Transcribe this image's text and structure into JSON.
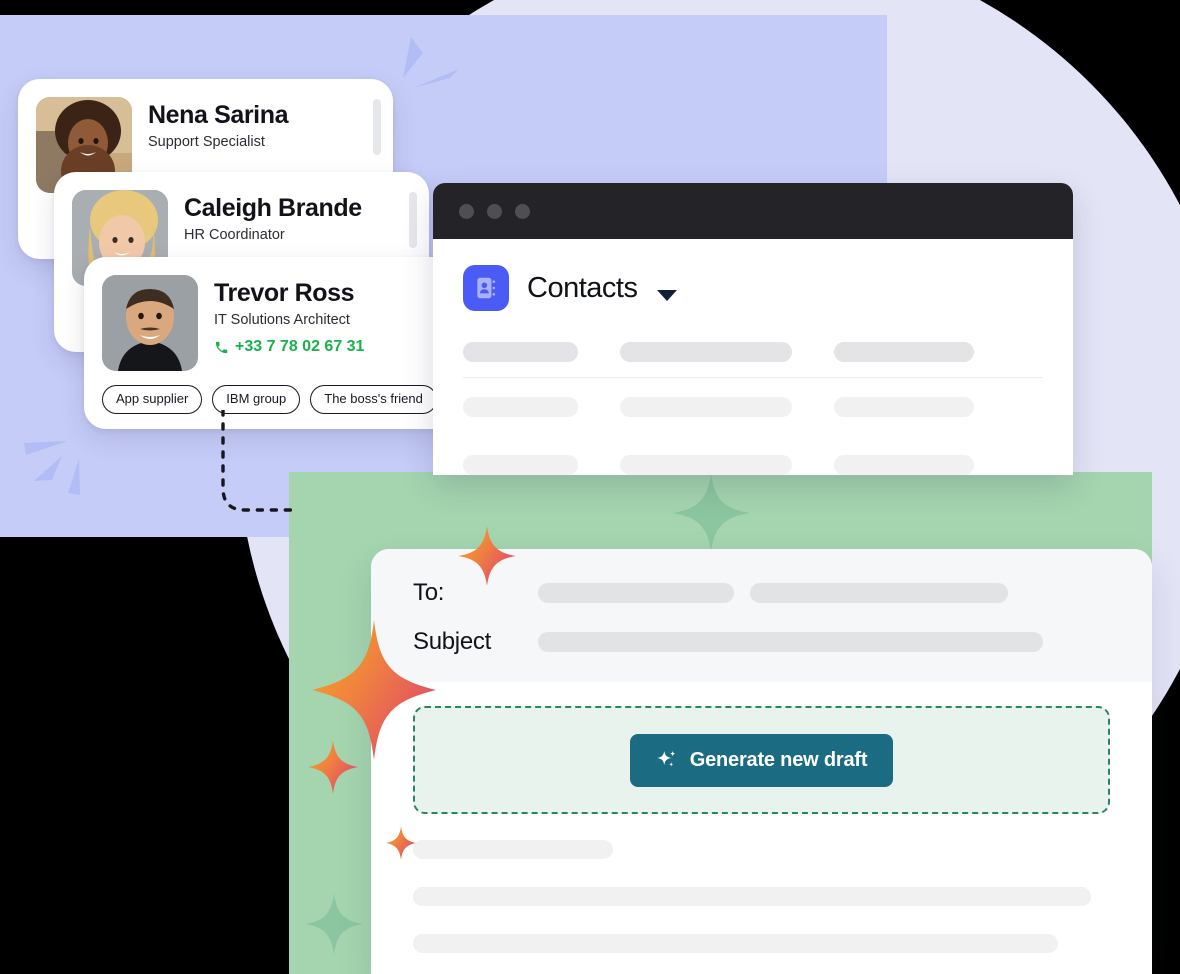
{
  "palette": {
    "lavender_panel": "#C6CCF8",
    "lavender_circle": "#E4E4F7",
    "green_panel": "#A4D5AF",
    "window_titlebar": "#242428",
    "contacts_app_blue": "#4B5BF5",
    "phone_green": "#18B24B",
    "generate_button_teal": "#1B6C82",
    "generate_zone_bg": "#E9F3EE",
    "generate_zone_border": "#2E8268",
    "skeleton_gray": "#F1F1F2",
    "sparkle_gradient_from": "#F5A623",
    "sparkle_gradient_to": "#E04E63"
  },
  "contact_cards": [
    {
      "name": "Nena Sarina",
      "role": "Support Specialist",
      "phone": "",
      "chips": []
    },
    {
      "name": "Caleigh Brande",
      "role": "HR Coordinator",
      "phone": "",
      "chips": []
    },
    {
      "name": "Trevor Ross",
      "role": "IT Solutions Architect",
      "phone": "+33 7 78 02 67 31",
      "chips": [
        "App supplier",
        "IBM group",
        "The boss's friend"
      ]
    }
  ],
  "contacts_window": {
    "title": "Contacts",
    "app_icon": "address-book-icon",
    "dropdown_icon": "chevron-down-icon",
    "traffic_lights": 3,
    "skeleton_rows": 3,
    "skeleton_columns": 3
  },
  "email_composer": {
    "to_label": "To:",
    "subject_label": "Subject",
    "to_value": "",
    "subject_value": "",
    "generate_button": {
      "label": "Generate new draft",
      "icon": "sparkles-icon"
    },
    "body_lines": 3
  }
}
